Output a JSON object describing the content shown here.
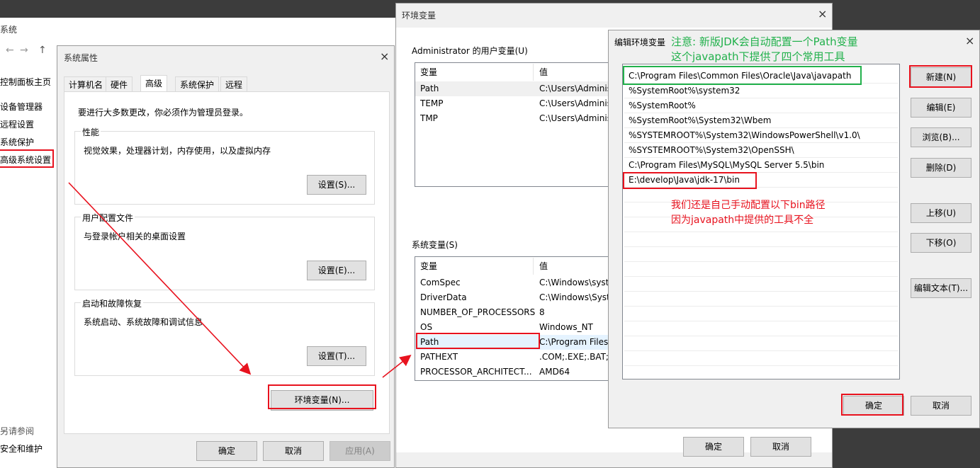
{
  "background_window": {
    "title": "系统",
    "nav": {
      "back": "←",
      "forward": "→",
      "up": "↑"
    },
    "sidebar": {
      "items": [
        "控制面板主页",
        "设备管理器",
        "远程设置",
        "系统保护",
        "高级系统设置"
      ],
      "see_also": "另请参阅",
      "security": "安全和维护"
    }
  },
  "system_properties": {
    "title": "系统属性",
    "tabs": [
      "计算机名",
      "硬件",
      "高级",
      "系统保护",
      "远程"
    ],
    "active_tab": "高级",
    "admin_note": "要进行大多数更改，你必须作为管理员登录。",
    "performance": {
      "title": "性能",
      "desc": "视觉效果，处理器计划，内存使用，以及虚拟内存",
      "button": "设置(S)..."
    },
    "user_profiles": {
      "title": "用户配置文件",
      "desc": "与登录帐户相关的桌面设置",
      "button": "设置(E)..."
    },
    "startup": {
      "title": "启动和故障恢复",
      "desc": "系统启动、系统故障和调试信息",
      "button": "设置(T)..."
    },
    "env_button": "环境变量(N)...",
    "ok": "确定",
    "cancel": "取消",
    "apply": "应用(A)"
  },
  "env_vars": {
    "title": "环境变量",
    "user_section": "Administrator 的用户变量(U)",
    "col_var": "变量",
    "col_val": "值",
    "user_vars": [
      {
        "name": "Path",
        "value": "C:\\Users\\Adminis"
      },
      {
        "name": "TEMP",
        "value": "C:\\Users\\Adminis"
      },
      {
        "name": "TMP",
        "value": "C:\\Users\\Adminis"
      }
    ],
    "system_section": "系统变量(S)",
    "system_vars": [
      {
        "name": "ComSpec",
        "value": "C:\\Windows\\syste"
      },
      {
        "name": "DriverData",
        "value": "C:\\Windows\\Syste"
      },
      {
        "name": "NUMBER_OF_PROCESSORS",
        "value": "8"
      },
      {
        "name": "OS",
        "value": "Windows_NT"
      },
      {
        "name": "Path",
        "value": "C:\\Program Files\\"
      },
      {
        "name": "PATHEXT",
        "value": ".COM;.EXE;.BAT;.C"
      },
      {
        "name": "PROCESSOR_ARCHITECT...",
        "value": "AMD64"
      }
    ],
    "ok": "确定",
    "cancel": "取消"
  },
  "edit_env": {
    "title": "编辑环境变量",
    "entries": [
      "C:\\Program Files\\Common Files\\Oracle\\Java\\javapath",
      "%SystemRoot%\\system32",
      "%SystemRoot%",
      "%SystemRoot%\\System32\\Wbem",
      "%SYSTEMROOT%\\System32\\WindowsPowerShell\\v1.0\\",
      "%SYSTEMROOT%\\System32\\OpenSSH\\",
      "C:\\Program Files\\MySQL\\MySQL Server 5.5\\bin",
      "E:\\develop\\Java\\jdk-17\\bin"
    ],
    "buttons": {
      "new": "新建(N)",
      "edit": "编辑(E)",
      "browse": "浏览(B)...",
      "delete": "删除(D)",
      "move_up": "上移(U)",
      "move_down": "下移(O)",
      "edit_text": "编辑文本(T)..."
    },
    "ok": "确定",
    "cancel": "取消"
  },
  "annotations": {
    "green_line1": "注意: 新版JDK会自动配置一个Path变量",
    "green_line2": "这个javapath下提供了四个常用工具",
    "red_line1": "我们还是自己手动配置以下bin路径",
    "red_line2": "因为javapath中提供的工具不全"
  },
  "colors": {
    "highlight_red": "#e8121e",
    "highlight_green": "#22b14c"
  },
  "icons": {
    "close": "×"
  }
}
